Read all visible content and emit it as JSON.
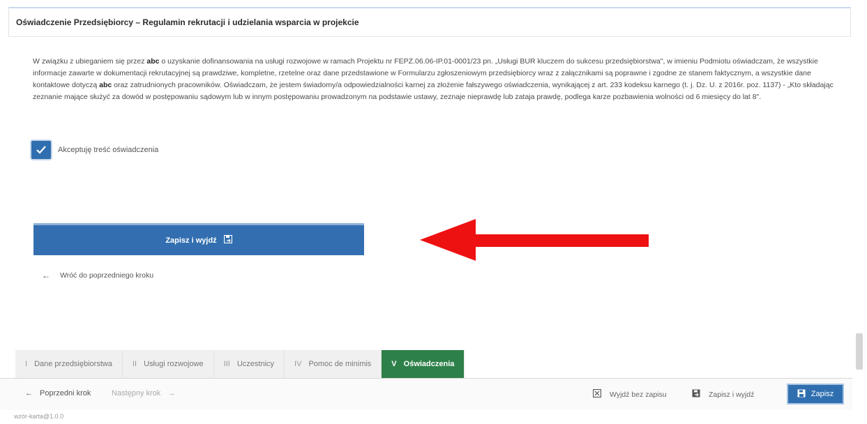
{
  "section": {
    "title": "Oświadczenie Przedsiębiorcy – Regulamin rekrutacji i udzielania wsparcia w projekcie"
  },
  "declaration": {
    "part1": "W związku z ubieganiem się przez ",
    "company": "abc",
    "part2": " o uzyskanie dofinansowania na usługi rozwojowe w ramach Projektu nr FEPZ.06.06-IP.01-0001/23 pn. „Usługi BUR kluczem do sukcesu przedsiębiorstwa\", w imieniu Podmiotu oświadczam, że wszystkie informacje zawarte w dokumentacji rekrutacyjnej są prawdziwe, kompletne, rzetelne oraz dane przedstawione w Formularzu zgłoszeniowym przedsiębiorcy wraz z załącznikami są poprawne i zgodne ze stanem faktycznym, a wszystkie dane kontaktowe dotyczą ",
    "company2": "abc",
    "part3": " oraz zatrudnionych pracowników. Oświadczam, że jestem świadomy/a odpowiedzialności karnej za złożenie fałszywego oświadczenia, wynikającej z art. 233 kodeksu karnego (t. j. Dz. U. z 2016r. poz. 1137) - „Kto składając zeznanie mające służyć za dowód w postępowaniu sądowym lub w innym postępowaniu prowadzonym na podstawie ustawy, zeznaje nieprawdę lub zataja prawdę, podlega karze pozbawienia wolności od 6 miesięcy do lat 8\"."
  },
  "checkbox": {
    "label": "Akceptuję treść oświadczenia",
    "checked": true
  },
  "actions": {
    "save_exit_label": "Zapisz i wyjdź",
    "back_label": "Wróć do poprzedniego kroku"
  },
  "tabs": [
    {
      "num": "I",
      "label": "Dane przedsiębiorstwa",
      "active": false
    },
    {
      "num": "II",
      "label": "Usługi rozwojowe",
      "active": false
    },
    {
      "num": "III",
      "label": "Uczestnicy",
      "active": false
    },
    {
      "num": "IV",
      "label": "Pomoc de minimis",
      "active": false
    },
    {
      "num": "V",
      "label": "Oświadczenia",
      "active": true
    }
  ],
  "footer": {
    "prev_label": "Poprzedni krok",
    "next_label": "Następny krok",
    "exit_nosave_label": "Wyjdź bez zapisu",
    "save_exit_label": "Zapisz i wyjdź",
    "save_label": "Zapisz",
    "version": "wzór-karta@1.0.0"
  },
  "colors": {
    "primary": "#336fb0",
    "active_tab": "#2e8049",
    "arrow": "#ee1111"
  }
}
